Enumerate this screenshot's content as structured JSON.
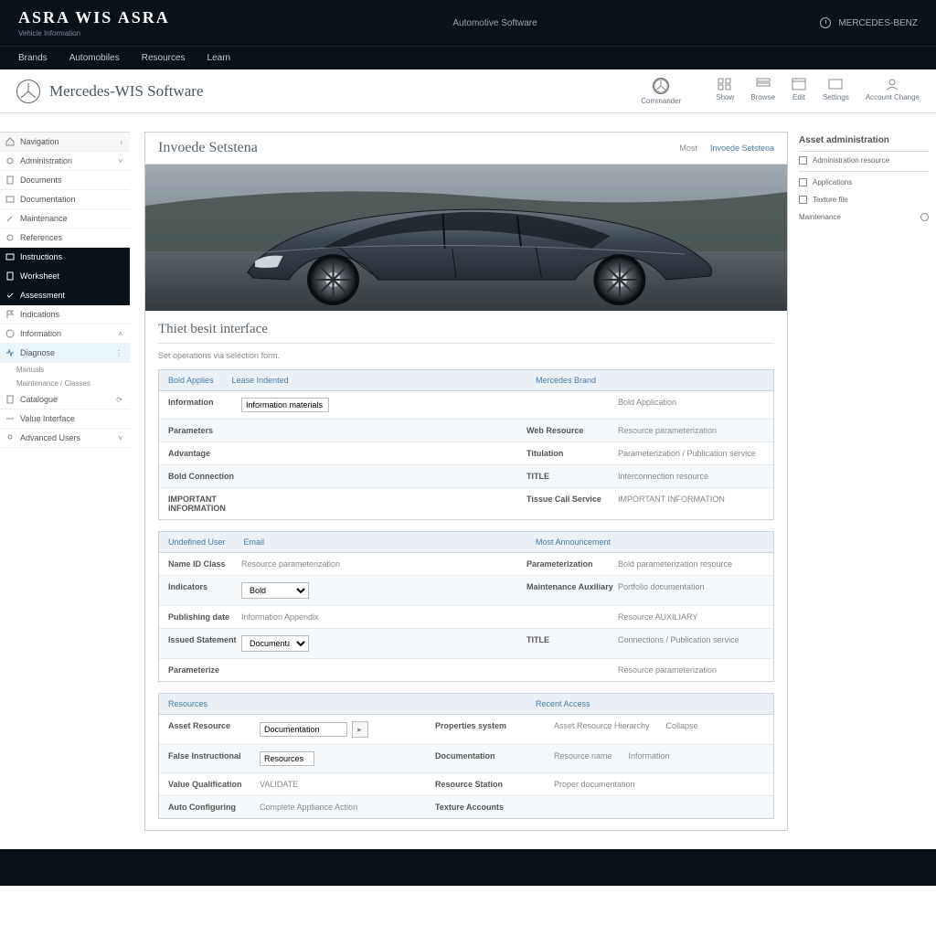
{
  "top": {
    "brand": "ASRA WIS ASRA",
    "brand_sub": "Vehicle Information",
    "center": "Automotive Software",
    "right": "MERCEDES-BENZ"
  },
  "main_nav": [
    "Brands",
    "Automobiles",
    "Resources",
    "Learn"
  ],
  "sub_header": {
    "title": "Mercedes-WIS Software",
    "action_main": "Commander",
    "actions": [
      "Show",
      "Browse",
      "Edit",
      "Settings",
      "Account Change"
    ]
  },
  "sidebar": {
    "items": [
      {
        "label": "Navigation",
        "chev": "›",
        "cls": "first"
      },
      {
        "label": "Administration",
        "chev": "˅"
      },
      {
        "label": "Documents"
      },
      {
        "label": "Documentation"
      },
      {
        "label": "Maintenance"
      },
      {
        "label": "References"
      },
      {
        "label": "Instructions",
        "cls": "active"
      },
      {
        "label": "Worksheet",
        "cls": "active"
      },
      {
        "label": "Assessment",
        "cls": "active"
      },
      {
        "label": "Indications"
      },
      {
        "label": "Information",
        "chev": "˄"
      },
      {
        "label": "Diagnose",
        "chev": "⋮",
        "cls": "sel"
      }
    ],
    "subs": [
      "Manuals",
      "Maintenance / Classes"
    ],
    "after": [
      {
        "label": "Catalogue",
        "chev": "⟳"
      },
      {
        "label": "Value Interface"
      },
      {
        "label": "Advanced Users",
        "chev": "˅"
      }
    ]
  },
  "panel": {
    "title": "Invoede Setstena",
    "actions_label": "Most",
    "action_link": "Invoede Setstena",
    "section_title": "Thiet besit interface",
    "section_desc": "Set operations via selection form."
  },
  "block1": {
    "head": [
      "Bold Applies",
      "Lease Indented",
      "Mercedes Brand"
    ],
    "rows": [
      {
        "c1": "Information",
        "c2_input": "Information materials",
        "c3": "",
        "c4": "Bold Application"
      },
      {
        "c1": "Parameters",
        "c2": "",
        "c3": "Web Resource",
        "c4": "Resource parameterization"
      },
      {
        "c1": "Advantage",
        "c2": "",
        "c3": "Titulation",
        "c4": "Parameterization / Publication service"
      },
      {
        "c1": "Bold Connection",
        "c2": "",
        "c3": "TITLE",
        "c4": "Interconnection resource"
      },
      {
        "c1": "IMPORTANT INFORMATION",
        "c2": "",
        "c3": "Tissue Call Service",
        "c4": "IMPORTANT INFORMATION"
      }
    ]
  },
  "block2": {
    "head": [
      "Undefined User",
      "Email",
      "Most Announcement"
    ],
    "rows": [
      {
        "c1": "Name ID Class",
        "c2": "Resource parameterization",
        "c3": "Parameterization",
        "c4": "Bold parameterization resource"
      },
      {
        "c1": "Indicators",
        "c2_select": "Bold",
        "c3": "Maintenance Auxiliary",
        "c4": "Portfolio documentation"
      },
      {
        "c1": "Publishing date",
        "c2": "Information Appendix",
        "c3": "",
        "c4": "Resource AUXILIARY"
      },
      {
        "c1": "Issued Statement",
        "c2_select2": "Documentation",
        "c3": "TITLE",
        "c4": "Connections / Publication service"
      },
      {
        "c1": "Parameterize",
        "c2": "",
        "c3": "",
        "c4": "Resource parameterization"
      }
    ]
  },
  "block3": {
    "head": [
      "Resources",
      "Recent Access"
    ],
    "rows": [
      {
        "c1": "Asset Resource",
        "c2_input": "Documentation",
        "btn": true,
        "c3": "Properties system",
        "c4a": "Asset Resource Hierarchy",
        "c4b": "Collapse"
      },
      {
        "c1": "False Instructional",
        "c2_input": "Resources",
        "c3": "Documentation",
        "c4a": "Resource name",
        "c4b": "Information"
      },
      {
        "c1": "Value Qualification",
        "c2": "VALIDATE",
        "c3": "Resource Station",
        "c4a": "Proper documentation",
        "c4b": ""
      },
      {
        "c1": "Auto Configuring",
        "c2": "Complete Appliance Action",
        "c3": "Texture Accounts",
        "c4a": "",
        "c4b": ""
      }
    ]
  },
  "rail": {
    "title": "Asset administration",
    "items": [
      "Administration resource",
      "Applications",
      "Texture file"
    ],
    "last": "Maintenance"
  }
}
